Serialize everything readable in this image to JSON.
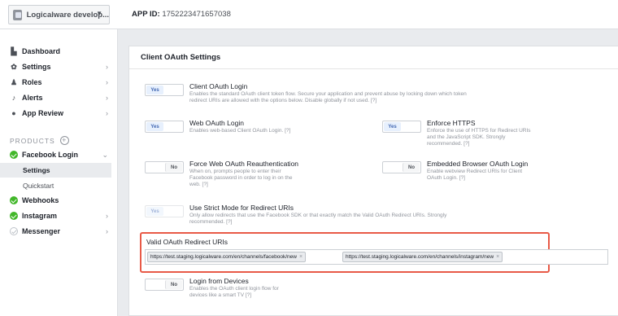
{
  "topbar": {
    "app_name": "Logicalware develop...",
    "app_id_label": "APP ID:",
    "app_id_value": "1752223471657038"
  },
  "sidebar": {
    "items": [
      {
        "label": "Dashboard",
        "icon": "dashboard-icon"
      },
      {
        "label": "Settings",
        "icon": "gear-icon"
      },
      {
        "label": "Roles",
        "icon": "roles-icon"
      },
      {
        "label": "Alerts",
        "icon": "bell-icon"
      },
      {
        "label": "App Review",
        "icon": "check-circle-icon"
      }
    ],
    "products_label": "PRODUCTS",
    "products": [
      {
        "label": "Facebook Login",
        "icon": "check-green-icon"
      },
      {
        "label": "Webhooks",
        "icon": "check-green-icon"
      },
      {
        "label": "Instagram",
        "icon": "check-green-icon"
      },
      {
        "label": "Messenger",
        "icon": "check-gray-icon"
      }
    ],
    "sub_items": [
      "Settings",
      "Quickstart"
    ]
  },
  "panel": {
    "title": "Client OAuth Settings",
    "settings": [
      {
        "title": "Client OAuth Login",
        "state": "Yes",
        "desc": "Enables the standard OAuth client token flow. Secure your application and prevent abuse by locking down which token redirect URIs are allowed with the options below. Disable globally if not used. [?]"
      },
      {
        "title": "Web OAuth Login",
        "state": "Yes",
        "desc": "Enables web-based Client OAuth Login. [?]"
      },
      {
        "title": "Enforce HTTPS",
        "state": "Yes",
        "desc": "Enforce the use of HTTPS for Redirect URIs and the JavaScript SDK. Strongly recommended. [?]"
      },
      {
        "title": "Force Web OAuth Reauthentication",
        "state": "No",
        "desc": "When on, prompts people to enter their Facebook password in order to log in on the web. [?]"
      },
      {
        "title": "Embedded Browser OAuth Login",
        "state": "No",
        "desc": "Enable webview Redirect URIs for Client OAuth Login. [?]"
      },
      {
        "title": "Use Strict Mode for Redirect URIs",
        "state": "Yes",
        "desc": "Only allow redirects that use the Facebook SDK or that exactly match the Valid OAuth Redirect URIs. Strongly recommended. [?]"
      },
      {
        "title": "Login from Devices",
        "state": "No",
        "desc": "Enables the OAuth client login flow for devices like a smart TV [?]"
      }
    ],
    "redirect_label": "Valid OAuth Redirect URIs",
    "redirect_uris": [
      "https://test.staging.logicalware.com/en/channels/facebook/new",
      "https://test.staging.logicalware.com/en/channels/instagram/new"
    ]
  },
  "colors": {
    "accent": "#4267b2",
    "success": "#42b72a",
    "highlight": "#e85a47"
  }
}
